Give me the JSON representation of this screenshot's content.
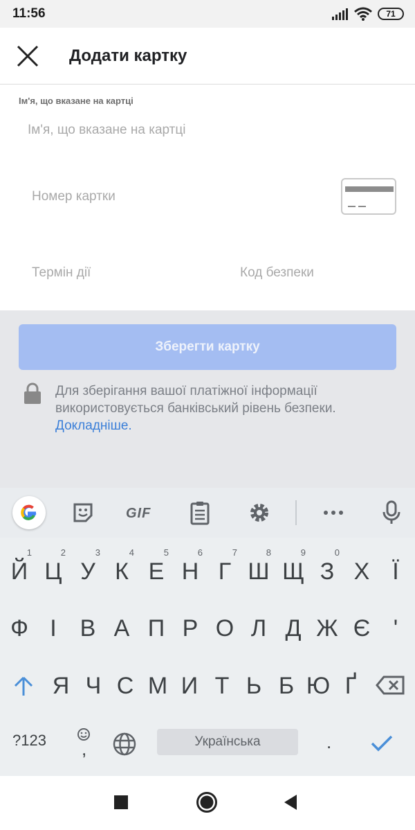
{
  "status_bar": {
    "time": "11:56",
    "battery": "71"
  },
  "app_bar": {
    "title": "Додати картку"
  },
  "form": {
    "name_label": "Ім'я, що вказане на картці",
    "name_placeholder": "Ім'я, що вказане на картці",
    "card_number_placeholder": "Номер картки",
    "expiry_placeholder": "Термін дії",
    "cvc_placeholder": "Код безпеки"
  },
  "save_button": {
    "label": "Зберегти картку",
    "color": "#a4bdf2"
  },
  "security": {
    "line1": "Для зберігання вашої платіжної інформації",
    "line2": "використовується банківський рівень безпеки.",
    "link": "Докладніше."
  },
  "keyboard": {
    "toolbar": [
      "google-icon",
      "sticker-icon",
      "GIF",
      "clipboard-icon",
      "gear-icon",
      "more-icon",
      "mic-icon"
    ],
    "gif_label": "GIF",
    "row1": [
      {
        "k": "Й",
        "h": "1"
      },
      {
        "k": "Ц",
        "h": "2"
      },
      {
        "k": "У",
        "h": "3"
      },
      {
        "k": "К",
        "h": "4"
      },
      {
        "k": "Е",
        "h": "5"
      },
      {
        "k": "Н",
        "h": "6"
      },
      {
        "k": "Г",
        "h": "7"
      },
      {
        "k": "Ш",
        "h": "8"
      },
      {
        "k": "Щ",
        "h": "9"
      },
      {
        "k": "З",
        "h": "0"
      },
      {
        "k": "Х",
        "h": ""
      },
      {
        "k": "Ї",
        "h": ""
      }
    ],
    "row2": [
      "Ф",
      "І",
      "В",
      "А",
      "П",
      "Р",
      "О",
      "Л",
      "Д",
      "Ж",
      "Є",
      "'"
    ],
    "row3": [
      "Я",
      "Ч",
      "С",
      "М",
      "И",
      "Т",
      "Ь",
      "Б",
      "Ю",
      "Ґ"
    ],
    "symbols_label": "?123",
    "emoji_comma": ",",
    "space_label": "Українська",
    "period": "."
  }
}
